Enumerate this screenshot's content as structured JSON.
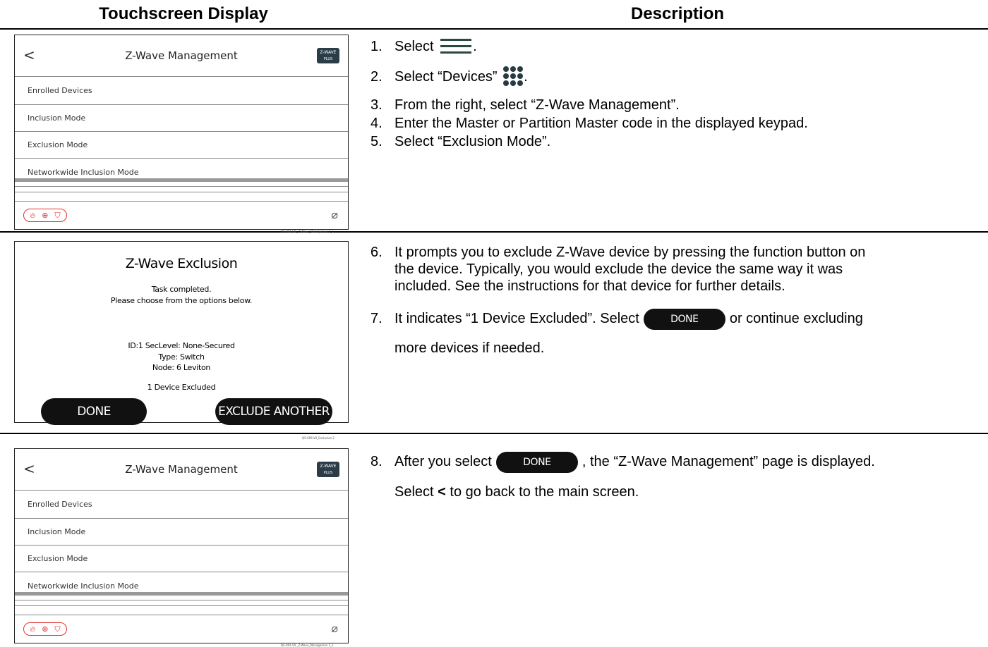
{
  "headers": {
    "left": "Touchscreen Display",
    "right": "Description"
  },
  "zwave_panel": {
    "back": "<",
    "title": "Z-Wave Management",
    "logo_top": "Z-WAVE",
    "logo_bottom": "PLUS",
    "rows": [
      "Enrolled Devices",
      "Inclusion Mode",
      "Exclusion Mode",
      "Networkwide Inclusion Mode"
    ],
    "emergency_icons": [
      "fire",
      "medical",
      "police"
    ],
    "no_alarm_symbol": "⌀",
    "caption": "QS-091-V0 _Z-Wave_Managemen 1_1"
  },
  "exclusion_panel": {
    "title": "Z-Wave Exclusion",
    "status1": "Task completed.",
    "status2": "Please choose from the options below.",
    "detail1": "ID:1 SecLevel: None-Secured",
    "detail2": "Type: Switch",
    "detail3": "Node: 6 Leviton",
    "result": "1 Device Excluded",
    "done": "DONE",
    "exclude_another": "EXCLUDE ANOTHER",
    "caption": "QS-096-V0_Exclusion 2"
  },
  "steps": {
    "s1_num": "1.",
    "s1_text": "Select",
    "s1_end": ".",
    "s2_num": "2.",
    "s2_text": "Select “Devices”",
    "s2_end": ".",
    "s3_num": "3.",
    "s3_text": "From the right, select “Z-Wave Management”.",
    "s4_num": "4.",
    "s4_text": "Enter the Master or Partition Master code in the displayed keypad.",
    "s5_num": "5.",
    "s5_text": "Select “Exclusion Mode”.",
    "s6_num": "6.",
    "s6_l1": "It prompts you to exclude Z-Wave device by pressing the function button on",
    "s6_l2": "the device.  Typically, you would exclude the device the same way it was",
    "s6_l3": "included.  See the instructions for that device for further details.",
    "s7_num": "7.",
    "s7_a": "It indicates “1 Device Excluded”.  Select",
    "s7_b": "or continue excluding",
    "s7_l2": "more devices if needed.",
    "s8_num": "8.",
    "s8_a": "After you select",
    "s8_b": ", the “Z-Wave Management” page is displayed.",
    "s8_l2a": "Select",
    "s8_l2b": "<",
    "s8_l2c": "to go back to the main screen.",
    "pill": "DONE"
  }
}
